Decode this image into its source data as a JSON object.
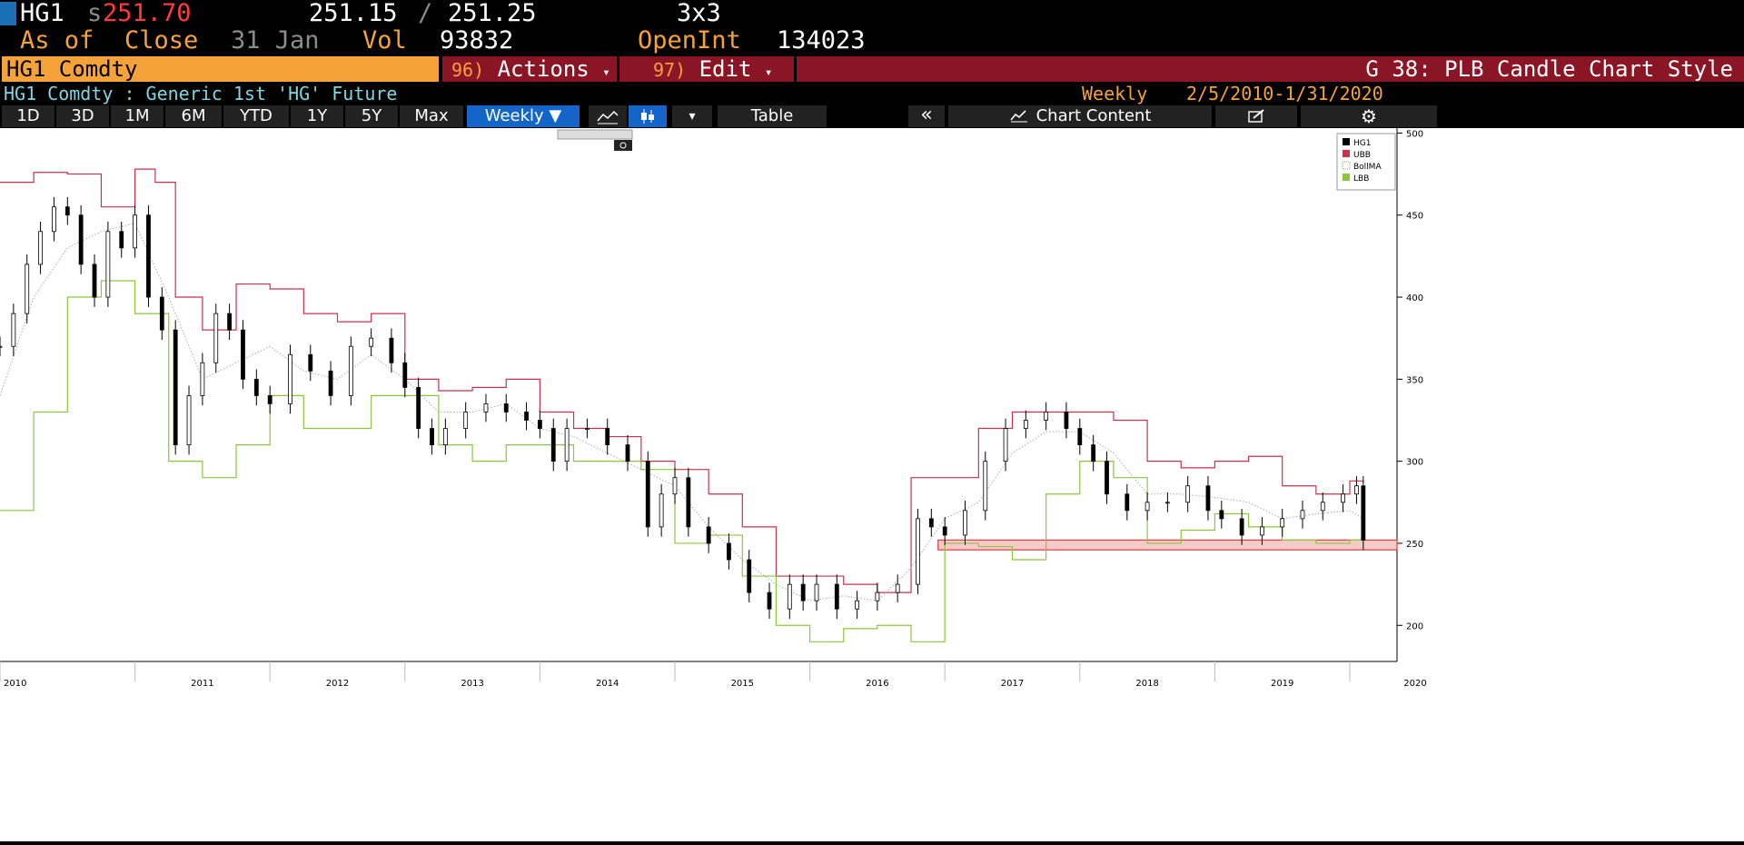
{
  "header": {
    "ticker": "HG1",
    "price_prefix": "s",
    "price": "251.70",
    "bid": "251.15",
    "separator": "/",
    "ask": "251.25",
    "size": "3x3",
    "as_of_label": "As of",
    "close_label": "Close",
    "date": "31 Jan",
    "vol_label": "Vol",
    "vol": "93832",
    "openint_label": "OpenInt",
    "openint": "134023"
  },
  "menubar": {
    "security": "HG1 Comdty",
    "actions_num": "96)",
    "actions_label": "Actions",
    "edit_num": "97)",
    "edit_label": "Edit",
    "chart_style": "G 38: PLB Candle Chart Style"
  },
  "subheader": {
    "description": "HG1 Comdty : Generic 1st 'HG' Future",
    "period": "Weekly",
    "range": "2/5/2010-1/31/2020"
  },
  "toolbar": {
    "periods": [
      "1D",
      "3D",
      "1M",
      "6M",
      "YTD",
      "1Y",
      "5Y",
      "Max"
    ],
    "frequency": "Weekly ▼",
    "table_label": "Table",
    "collapse_glyph": "«",
    "chart_content_label": "Chart Content",
    "caret": "▾",
    "colors": {
      "toolbar_bg": "#222222",
      "selected_bg": "#1366c8"
    }
  },
  "chart_data": {
    "type": "line",
    "title": "",
    "xlabel": "",
    "ylabel": "",
    "ylim": [
      178,
      503
    ],
    "yticks": [
      200,
      250,
      300,
      350,
      400,
      450,
      500
    ],
    "xlim": [
      2010.0,
      2020.35
    ],
    "xticks": [
      "2010",
      "2011",
      "2012",
      "2013",
      "2014",
      "2015",
      "2016",
      "2017",
      "2018",
      "2019",
      "2020"
    ],
    "legend": {
      "position": "top-right",
      "entries": [
        "HG1",
        "UBB",
        "BollMA",
        "LBB"
      ]
    },
    "colors": {
      "HG1": "#000000",
      "UBB": "#c8324f",
      "BollMA": "#aaaaaa",
      "LBB": "#8cc63f",
      "support": "#e03c3c"
    },
    "grid": false,
    "series": [
      {
        "name": "HG1",
        "style": "candlestick",
        "x": [
          2010.0,
          2010.1,
          2010.2,
          2010.3,
          2010.4,
          2010.5,
          2010.6,
          2010.7,
          2010.8,
          2010.9,
          2011.0,
          2011.1,
          2011.2,
          2011.3,
          2011.4,
          2011.5,
          2011.6,
          2011.7,
          2011.8,
          2011.9,
          2012.0,
          2012.15,
          2012.3,
          2012.45,
          2012.6,
          2012.75,
          2012.9,
          2013.0,
          2013.1,
          2013.2,
          2013.3,
          2013.45,
          2013.6,
          2013.75,
          2013.9,
          2014.0,
          2014.1,
          2014.2,
          2014.35,
          2014.5,
          2014.65,
          2014.8,
          2014.9,
          2015.0,
          2015.1,
          2015.25,
          2015.4,
          2015.55,
          2015.7,
          2015.85,
          2015.95,
          2016.05,
          2016.2,
          2016.35,
          2016.5,
          2016.65,
          2016.8,
          2016.9,
          2017.0,
          2017.15,
          2017.3,
          2017.45,
          2017.6,
          2017.75,
          2017.9,
          2018.0,
          2018.1,
          2018.2,
          2018.35,
          2018.5,
          2018.65,
          2018.8,
          2018.95,
          2019.05,
          2019.2,
          2019.35,
          2019.5,
          2019.65,
          2019.8,
          2019.95,
          2020.05,
          2020.1
        ],
        "values": [
          370,
          390,
          420,
          440,
          455,
          450,
          420,
          400,
          440,
          430,
          450,
          400,
          380,
          310,
          340,
          360,
          390,
          380,
          350,
          340,
          335,
          365,
          355,
          340,
          370,
          375,
          360,
          345,
          320,
          310,
          320,
          330,
          335,
          330,
          325,
          320,
          300,
          320,
          320,
          310,
          300,
          260,
          280,
          290,
          260,
          250,
          240,
          220,
          210,
          225,
          215,
          225,
          210,
          215,
          220,
          225,
          265,
          260,
          255,
          270,
          300,
          320,
          325,
          330,
          320,
          310,
          300,
          280,
          270,
          275,
          275,
          285,
          270,
          265,
          255,
          260,
          265,
          270,
          275,
          280,
          285,
          252
        ]
      },
      {
        "name": "UBB",
        "style": "step",
        "x": [
          2010.0,
          2010.25,
          2010.5,
          2010.75,
          2011.0,
          2011.15,
          2011.3,
          2011.5,
          2011.75,
          2012.0,
          2012.25,
          2012.5,
          2012.75,
          2013.0,
          2013.25,
          2013.5,
          2013.75,
          2014.0,
          2014.25,
          2014.5,
          2014.75,
          2015.0,
          2015.25,
          2015.5,
          2015.75,
          2016.0,
          2016.25,
          2016.5,
          2016.75,
          2017.0,
          2017.25,
          2017.5,
          2017.75,
          2018.0,
          2018.25,
          2018.5,
          2018.75,
          2019.0,
          2019.25,
          2019.5,
          2019.75,
          2020.0,
          2020.1
        ],
        "values": [
          470,
          476,
          475,
          455,
          478,
          470,
          400,
          380,
          408,
          405,
          390,
          385,
          390,
          350,
          343,
          345,
          350,
          330,
          320,
          315,
          300,
          295,
          280,
          260,
          230,
          230,
          225,
          220,
          290,
          290,
          320,
          330,
          330,
          330,
          325,
          300,
          296,
          300,
          303,
          285,
          280,
          288,
          287
        ]
      },
      {
        "name": "BollMA",
        "style": "dotted",
        "x": [
          2010.0,
          2010.25,
          2010.5,
          2010.75,
          2011.0,
          2011.25,
          2011.5,
          2011.75,
          2012.0,
          2012.25,
          2012.5,
          2012.75,
          2013.0,
          2013.25,
          2013.5,
          2013.75,
          2014.0,
          2014.25,
          2014.5,
          2014.75,
          2015.0,
          2015.25,
          2015.5,
          2015.75,
          2016.0,
          2016.25,
          2016.5,
          2016.75,
          2017.0,
          2017.25,
          2017.5,
          2017.75,
          2018.0,
          2018.25,
          2018.5,
          2018.75,
          2019.0,
          2019.25,
          2019.5,
          2019.75,
          2020.0,
          2020.1
        ],
        "values": [
          340,
          400,
          430,
          440,
          445,
          400,
          350,
          360,
          370,
          355,
          350,
          365,
          350,
          330,
          330,
          335,
          320,
          315,
          305,
          295,
          285,
          260,
          240,
          225,
          215,
          218,
          215,
          235,
          265,
          275,
          305,
          318,
          318,
          305,
          280,
          280,
          278,
          275,
          265,
          268,
          270,
          265
        ]
      },
      {
        "name": "LBB",
        "style": "step",
        "x": [
          2010.0,
          2010.25,
          2010.5,
          2010.75,
          2011.0,
          2011.25,
          2011.5,
          2011.75,
          2012.0,
          2012.25,
          2012.5,
          2012.75,
          2013.0,
          2013.25,
          2013.5,
          2013.75,
          2014.0,
          2014.25,
          2014.5,
          2014.75,
          2015.0,
          2015.25,
          2015.5,
          2015.75,
          2016.0,
          2016.25,
          2016.5,
          2016.75,
          2017.0,
          2017.25,
          2017.5,
          2017.75,
          2018.0,
          2018.25,
          2018.5,
          2018.75,
          2019.0,
          2019.25,
          2019.5,
          2019.75,
          2020.0,
          2020.1
        ],
        "values": [
          270,
          330,
          400,
          410,
          390,
          300,
          290,
          310,
          340,
          320,
          320,
          340,
          340,
          310,
          300,
          310,
          310,
          300,
          300,
          295,
          250,
          255,
          230,
          200,
          190,
          198,
          200,
          190,
          250,
          248,
          240,
          280,
          300,
          290,
          250,
          258,
          268,
          260,
          252,
          250,
          252,
          250
        ]
      }
    ],
    "annotations": [
      {
        "type": "horizontal_band",
        "y0": 246,
        "y1": 252,
        "x_start": 2016.95,
        "x_end": 2020.35
      }
    ]
  }
}
